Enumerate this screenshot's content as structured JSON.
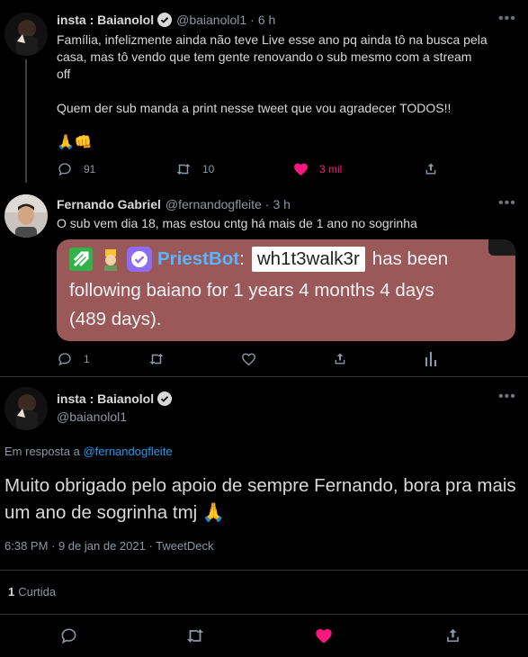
{
  "tweet1": {
    "name": "insta : Baianolol",
    "handle": "@baianolol1",
    "time": "6 h",
    "text_line1": "Família, infelizmente ainda não teve Live esse ano pq ainda tô na busca pela",
    "text_line2": "casa, mas tô vendo que tem gente renovando o sub mesmo com a stream",
    "text_line3": "off",
    "text_line4": "Quem der sub manda a print nesse tweet que vou agradecer TODOS!!",
    "emojis": "🙏👊",
    "replies": "91",
    "retweets": "10",
    "likes": "3 mil"
  },
  "tweet2": {
    "name": "Fernando Gabriel",
    "handle": "@fernandogfleite",
    "time": "3 h",
    "text": "O sub vem dia 18, mas estou cntg há mais de 1 ano no sogrinha",
    "replies": "1",
    "embed": {
      "bot_name": "PriestBot",
      "colon": ":",
      "username": "wh1t3walk3r",
      "line1_end": "has been",
      "line2": "following baiano for 1 years 4 months 4 days",
      "line3": "(489 days)."
    }
  },
  "tweet3": {
    "name": "insta : Baianolol",
    "handle": "@baianolol1",
    "reply_prefix": "Em resposta a",
    "reply_to": "@fernandogfleite",
    "text": "Muito obrigado pelo apoio de sempre Fernando, bora pra mais um ano de sogrinha tmj 🙏",
    "meta": "6:38 PM · 9 de jan de 2021 · TweetDeck",
    "retweet_count": "1",
    "retweet_label": "Curtida"
  },
  "colors": {
    "like_red": "#f91880",
    "link_blue": "#1d9bf0",
    "verified_blue": "#8b98a5",
    "embed_bg": "#9a5859"
  },
  "separator_dot": "·",
  "more_glyph": "•••"
}
